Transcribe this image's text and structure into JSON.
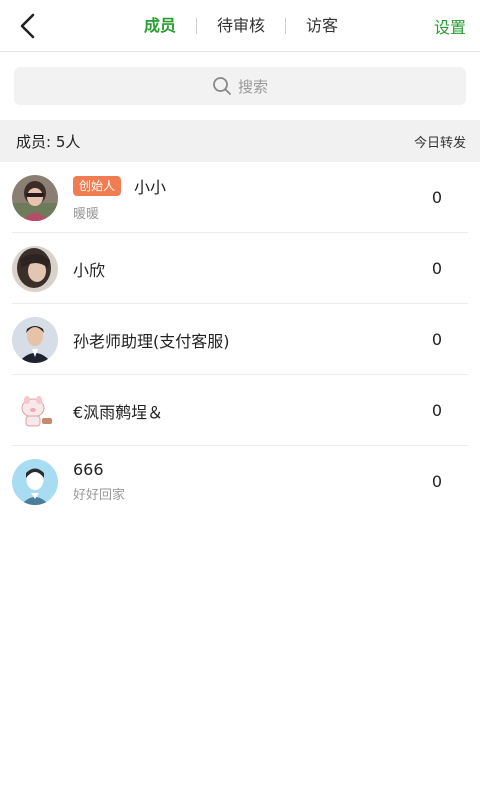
{
  "nav": {
    "back_icon": "chevron-left-icon",
    "tabs": [
      {
        "label": "成员",
        "active": true
      },
      {
        "label": "待审核",
        "active": false
      },
      {
        "label": "访客",
        "active": false
      }
    ],
    "settings_label": "设置",
    "accent_color": "#2a9d32"
  },
  "search": {
    "icon": "search-icon",
    "placeholder": "搜索"
  },
  "members_header": {
    "count_label": "成员: 5人",
    "forward_label": "今日转发"
  },
  "members": [
    {
      "badge": "创始人",
      "name": "小小",
      "sub": "暖暖",
      "count": "0",
      "avatar": "photo-woman-sunglasses"
    },
    {
      "badge": "",
      "name": "小欣",
      "sub": "",
      "count": "0",
      "avatar": "photo-woman-dark-hair"
    },
    {
      "badge": "",
      "name": "孙老师助理(支付客服)",
      "sub": "",
      "count": "0",
      "avatar": "photo-man-suit"
    },
    {
      "badge": "",
      "name": "€沨雨鹩埕＆",
      "sub": "",
      "count": "0",
      "avatar": "cartoon-pig"
    },
    {
      "badge": "",
      "name": "666",
      "sub": "好好回家",
      "count": "0",
      "avatar": "default-avatar"
    }
  ]
}
